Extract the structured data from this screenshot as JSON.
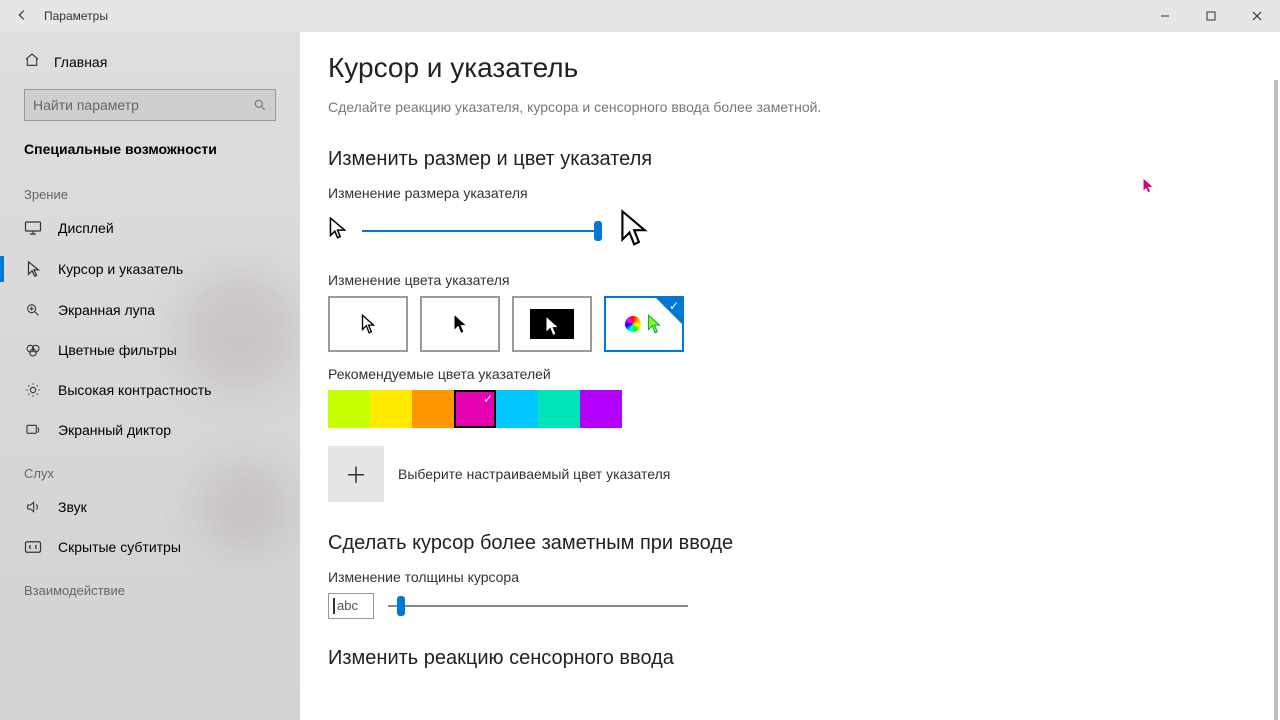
{
  "titlebar": {
    "title": "Параметры"
  },
  "sidebar": {
    "home": "Главная",
    "search_placeholder": "Найти параметр",
    "section": "Специальные возможности",
    "groups": [
      {
        "label": "Зрение",
        "items": [
          {
            "id": "display",
            "icon": "monitor",
            "label": "Дисплей"
          },
          {
            "id": "cursor",
            "icon": "cursor",
            "label": "Курсор и указатель",
            "selected": true
          },
          {
            "id": "magnifier",
            "icon": "zoom",
            "label": "Экранная лупа"
          },
          {
            "id": "filters",
            "icon": "palette",
            "label": "Цветные фильтры"
          },
          {
            "id": "contrast",
            "icon": "sun",
            "label": "Высокая контрастность"
          },
          {
            "id": "narrator",
            "icon": "narrator",
            "label": "Экранный диктор"
          }
        ]
      },
      {
        "label": "Слух",
        "items": [
          {
            "id": "audio",
            "icon": "speaker",
            "label": "Звук"
          },
          {
            "id": "captions",
            "icon": "cc",
            "label": "Скрытые субтитры"
          }
        ]
      },
      {
        "label": "Взаимодействие",
        "items": []
      }
    ]
  },
  "content": {
    "page_title": "Курсор и указатель",
    "subtitle": "Сделайте реакцию указателя, курсора и сенсорного ввода более заметной.",
    "section1": "Изменить размер и цвет указателя",
    "size_label": "Изменение размера указателя",
    "size_value_pct": 100,
    "color_label": "Изменение цвета указателя",
    "pointer_styles": [
      {
        "id": "white",
        "kind": "white-cursor"
      },
      {
        "id": "black",
        "kind": "black-cursor"
      },
      {
        "id": "inverted",
        "kind": "inverted-cursor"
      },
      {
        "id": "custom",
        "kind": "custom-color",
        "selected": true
      }
    ],
    "rec_label": "Рекомендуемые цвета указателей",
    "rec_colors": [
      {
        "hex": "#c6ff00"
      },
      {
        "hex": "#ffeb00"
      },
      {
        "hex": "#ff9800"
      },
      {
        "hex": "#e500b0",
        "selected": true
      },
      {
        "hex": "#00c8ff"
      },
      {
        "hex": "#00e5b9"
      },
      {
        "hex": "#b300ff"
      }
    ],
    "custom_label": "Выберите настраиваемый цвет указателя",
    "section2": "Сделать курсор более заметным при вводе",
    "thickness_label": "Изменение толщины курсора",
    "thickness_sample": "abc",
    "thickness_value_pct": 3,
    "section3": "Изменить реакцию сенсорного ввода"
  }
}
